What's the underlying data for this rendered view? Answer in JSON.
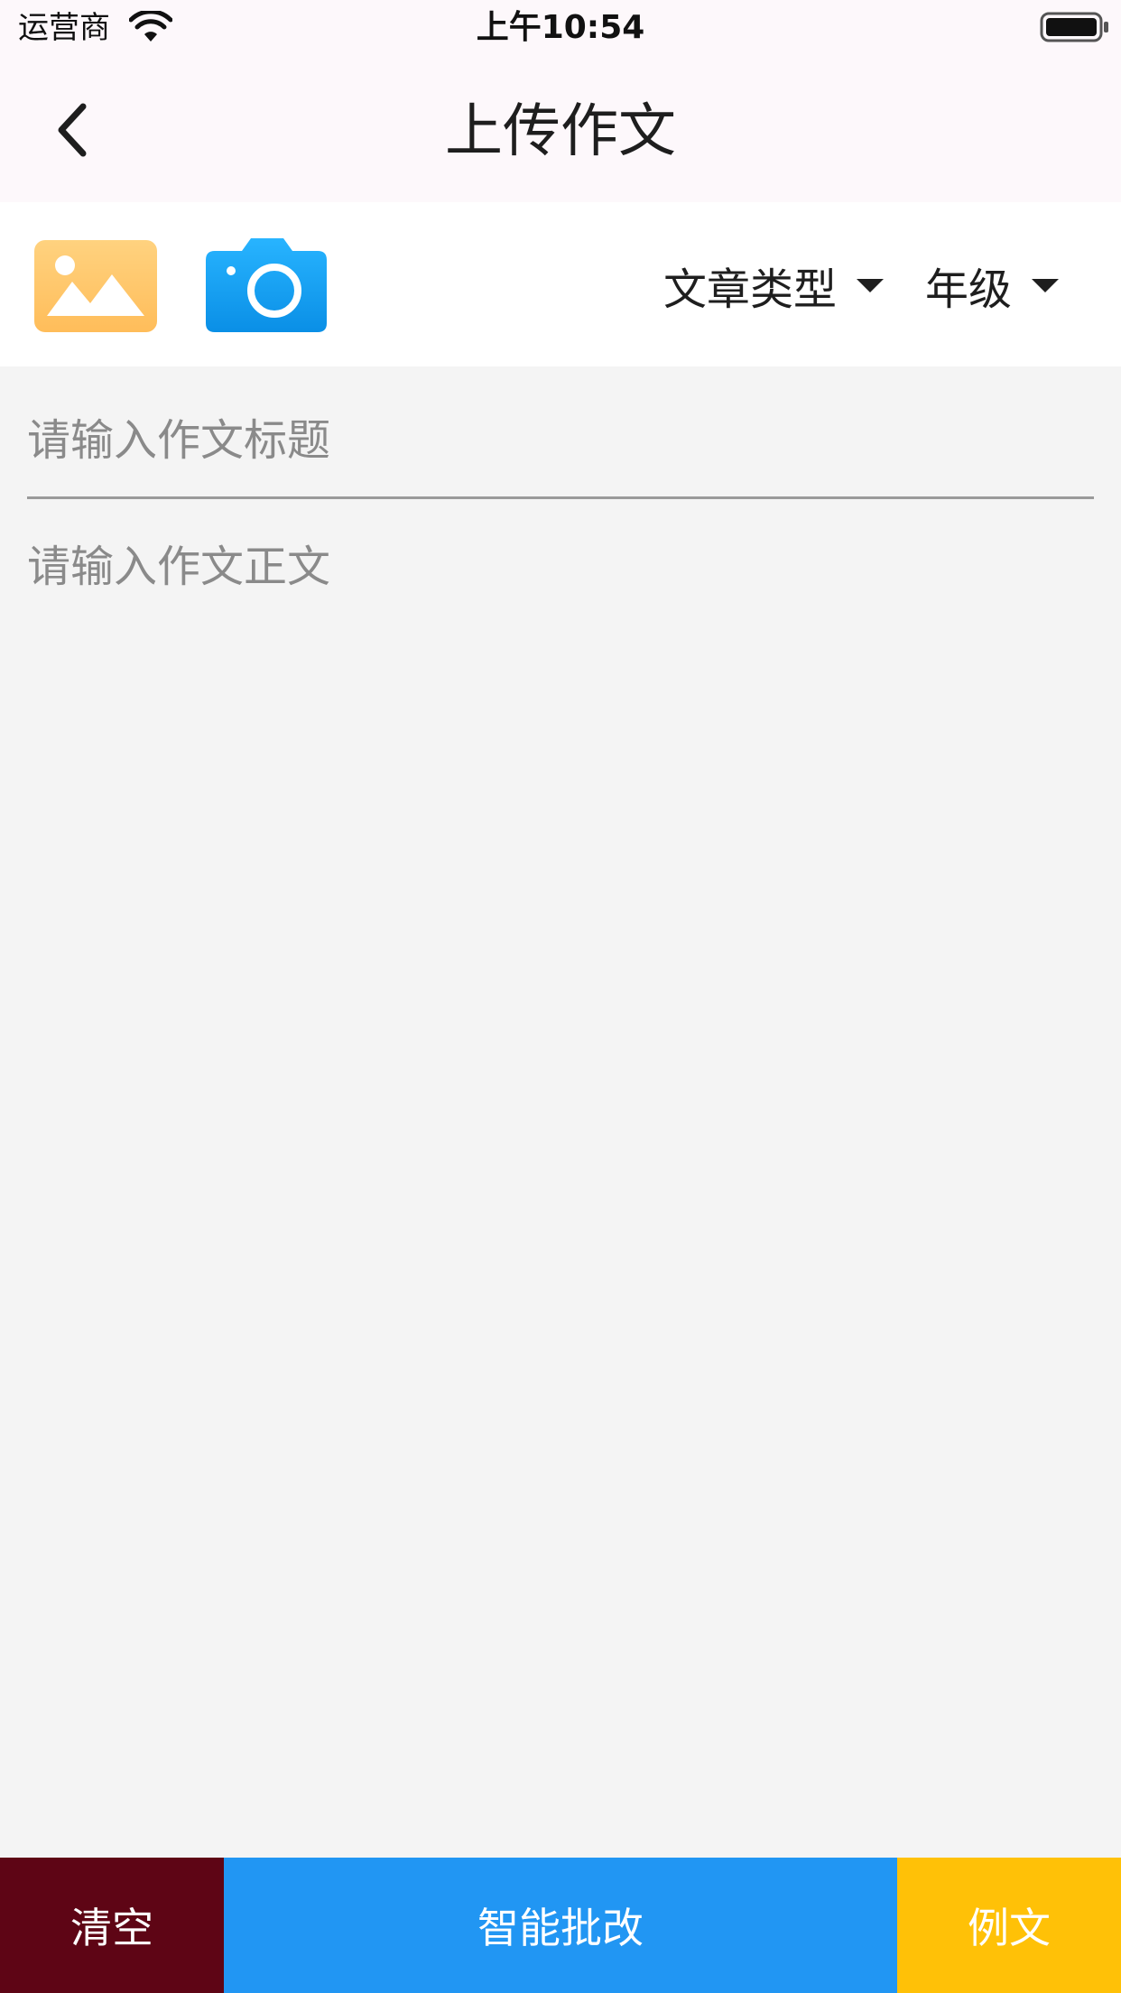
{
  "status_bar": {
    "carrier": "运营商",
    "time": "上午10:54",
    "icons": [
      "wifi-icon",
      "battery-icon"
    ]
  },
  "nav": {
    "title": "上传作文",
    "back_icon": "chevron-left-icon"
  },
  "toolbar": {
    "gallery_icon": "image-gallery-icon",
    "camera_icon": "camera-icon",
    "article_type_label": "文章类型",
    "grade_label": "年级"
  },
  "editor": {
    "title_placeholder": "请输入作文标题",
    "title_value": "",
    "body_placeholder": "请输入作文正文",
    "body_value": ""
  },
  "bottom_bar": {
    "clear_label": "清空",
    "grade_label": "智能批改",
    "sample_label": "例文"
  },
  "colors": {
    "clear_button": "#5e0515",
    "grade_button": "#2196f3",
    "sample_button": "#ffc107",
    "gallery_icon": "#ffc66a",
    "camera_icon": "#139ff0",
    "editor_bg": "#f4f4f4",
    "nav_bg": "#fdf8fb"
  }
}
